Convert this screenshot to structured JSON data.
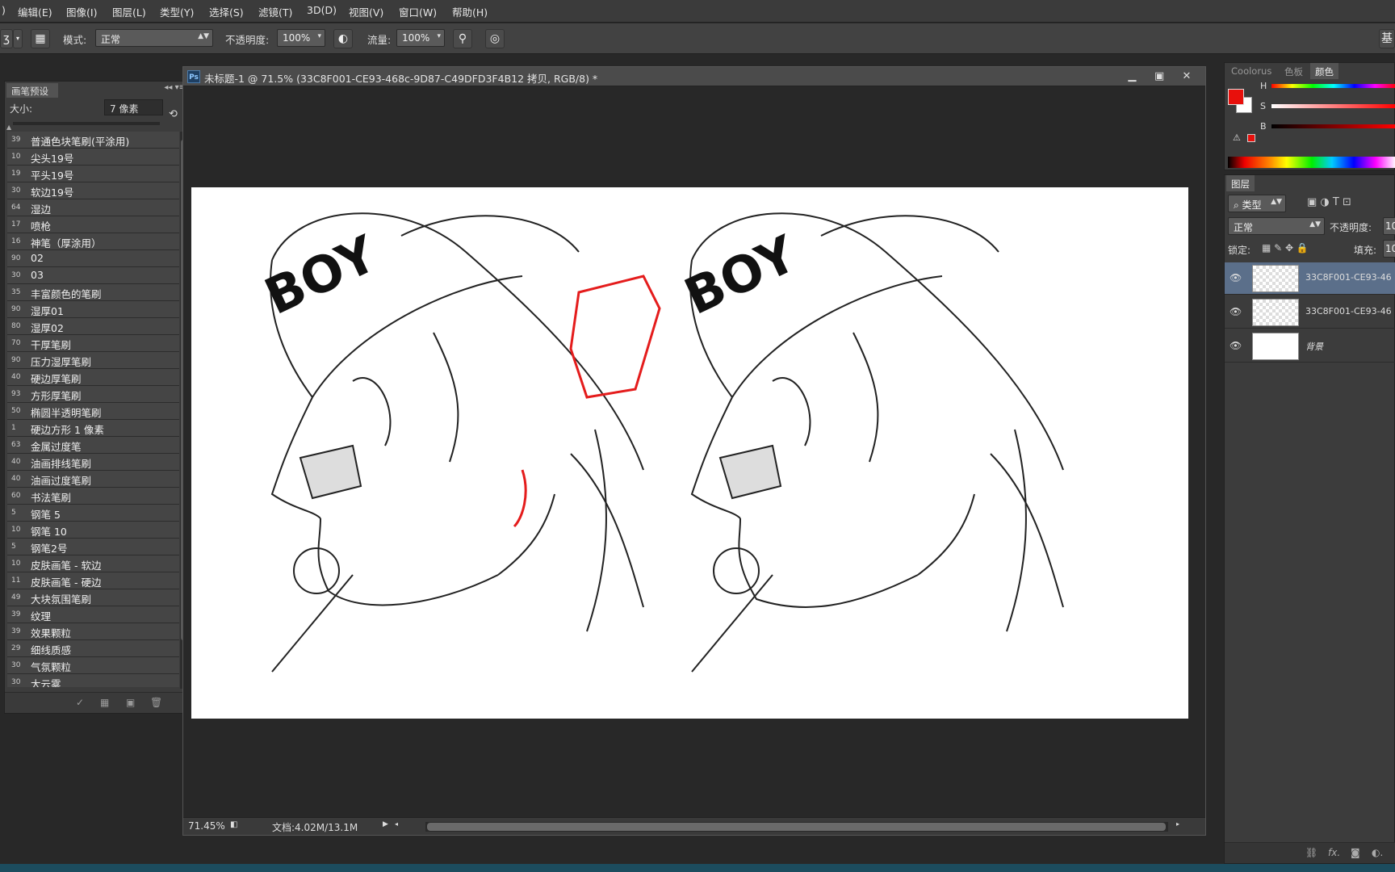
{
  "menu": [
    "编辑(E)",
    "图像(I)",
    "图层(L)",
    "类型(Y)",
    "选择(S)",
    "滤镜(T)",
    "3D(D)",
    "视图(V)",
    "窗口(W)",
    "帮助(H)"
  ],
  "options": {
    "mode_label": "模式:",
    "mode_value": "正常",
    "opacity_label": "不透明度:",
    "opacity_value": "100%",
    "flow_label": "流量:",
    "flow_value": "100%"
  },
  "brush_panel": {
    "tab": "画笔预设",
    "size_label": "大小:",
    "size_value": "7 像素",
    "brushes": [
      {
        "n": "39",
        "t": "普通色块笔刷(平涂用)"
      },
      {
        "n": "10",
        "t": "尖头19号"
      },
      {
        "n": "19",
        "t": "平头19号"
      },
      {
        "n": "30",
        "t": "软边19号"
      },
      {
        "n": "64",
        "t": "湿边"
      },
      {
        "n": "17",
        "t": "喷枪"
      },
      {
        "n": "16",
        "t": "神笔（厚涂用）"
      },
      {
        "n": "90",
        "t": "02"
      },
      {
        "n": "30",
        "t": "03"
      },
      {
        "n": "35",
        "t": "丰富颜色的笔刷"
      },
      {
        "n": "90",
        "t": "湿厚01"
      },
      {
        "n": "80",
        "t": "湿厚02"
      },
      {
        "n": "70",
        "t": "干厚笔刷"
      },
      {
        "n": "90",
        "t": "压力湿厚笔刷"
      },
      {
        "n": "40",
        "t": "硬边厚笔刷"
      },
      {
        "n": "93",
        "t": "方形厚笔刷"
      },
      {
        "n": "50",
        "t": "椭圆半透明笔刷"
      },
      {
        "n": "1",
        "t": "硬边方形 1 像素"
      },
      {
        "n": "63",
        "t": "金属过度笔"
      },
      {
        "n": "40",
        "t": "油画排线笔刷"
      },
      {
        "n": "40",
        "t": "油画过度笔刷"
      },
      {
        "n": "60",
        "t": "书法笔刷"
      },
      {
        "n": "5",
        "t": "钢笔 5"
      },
      {
        "n": "10",
        "t": "钢笔 10"
      },
      {
        "n": "5",
        "t": "钢笔2号"
      },
      {
        "n": "10",
        "t": "皮肤画笔 - 软边"
      },
      {
        "n": "11",
        "t": "皮肤画笔 - 硬边"
      },
      {
        "n": "49",
        "t": "大块氛围笔刷"
      },
      {
        "n": "39",
        "t": "纹理"
      },
      {
        "n": "39",
        "t": "效果颗粒"
      },
      {
        "n": "29",
        "t": "细线质感"
      },
      {
        "n": "30",
        "t": "气氛颗粒"
      },
      {
        "n": "30",
        "t": "大云雾"
      }
    ]
  },
  "document": {
    "title": "未标题-1 @ 71.5% (33C8F001-CE93-468c-9D87-C49DFD3F4B12 拷贝, RGB/8) *",
    "zoom": "71.45%",
    "doc_info": "文档:4.02M/13.1M"
  },
  "color_panel": {
    "tabs": [
      "Coolorus",
      "色板",
      "颜色"
    ],
    "labels": [
      "H",
      "S",
      "B"
    ],
    "fg_color": "#e8100c",
    "bg_color": "#ffffff"
  },
  "layers_panel": {
    "tab": "图层",
    "filter": "类型",
    "blend": "正常",
    "opacity_label": "不透明度:",
    "opacity_value": "10",
    "lock_label": "锁定:",
    "fill_label": "填充:",
    "fill_value": "10",
    "layers": [
      {
        "name": "33C8F001-CE93-46",
        "selected": true
      },
      {
        "name": "33C8F001-CE93-46",
        "selected": false
      },
      {
        "name": "背景",
        "selected": false
      }
    ]
  }
}
